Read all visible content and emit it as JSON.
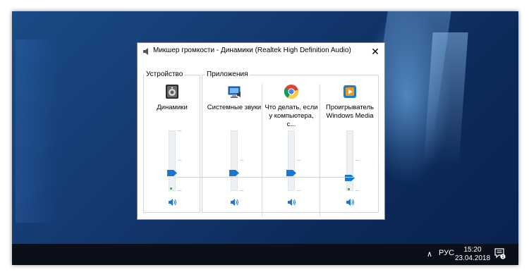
{
  "window": {
    "title": "Микшер громкости - Динамики (Realtek High Definition Audio)",
    "close_symbol": "✕"
  },
  "groups": {
    "device_label": "Устройство",
    "apps_label": "Приложения"
  },
  "channels": [
    {
      "name": "Динамики",
      "icon": "speaker-device-icon",
      "level": 0.3
    },
    {
      "name": "Системные звуки",
      "icon": "system-sounds-icon",
      "level": 0.3
    },
    {
      "name": "Что делать, если у компьютера, с...",
      "icon": "chrome-icon",
      "level": 0.3
    },
    {
      "name": "Проигрыватель Windows Media",
      "icon": "windows-media-player-icon",
      "level": 0.22
    }
  ],
  "taskbar": {
    "language": "РУС",
    "time": "15:20",
    "date": "23.04.2018",
    "notification_count": "1"
  },
  "colors": {
    "accent": "#1976d2",
    "desktop": "#13386f",
    "taskbar": "#0a0f1a",
    "meter": "#2fb94a"
  }
}
